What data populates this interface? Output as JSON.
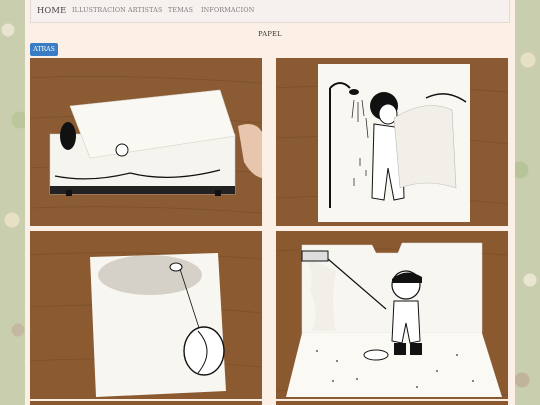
{
  "nav": {
    "home": "HOME",
    "items": [
      "ILLUSTRACION",
      "ARTISTAS",
      "TEMAS",
      "INFORMACION"
    ]
  },
  "page": {
    "title": "PAPEL",
    "back_label": "ATRAS"
  },
  "gallery": [
    {
      "id": "tissue-box"
    },
    {
      "id": "shower"
    },
    {
      "id": "yoyo"
    },
    {
      "id": "painter"
    }
  ],
  "colors": {
    "accent": "#3b7dc4",
    "wood": "#8a5a32",
    "paper": "#f7f4ee"
  }
}
